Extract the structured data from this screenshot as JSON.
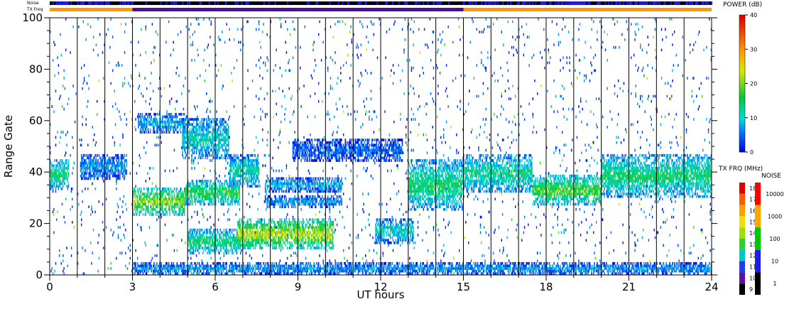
{
  "chart_data": {
    "type": "heatmap",
    "xlabel": "UT hours",
    "ylabel": "Range Gate",
    "xlim": [
      0,
      24
    ],
    "ylim": [
      0,
      100
    ],
    "x_ticks": [
      0,
      3,
      6,
      9,
      12,
      15,
      18,
      21,
      24
    ],
    "y_ticks": [
      0,
      20,
      40,
      60,
      80,
      100
    ],
    "grid_vertical_hours": [
      1,
      2,
      3,
      4,
      5,
      6,
      7,
      8,
      9,
      10,
      11,
      12,
      13,
      14,
      15,
      16,
      17,
      18,
      19,
      20,
      21,
      22,
      23
    ],
    "top_bars": {
      "noise_label": "Noise",
      "txfreq_label": "TX Freq",
      "txfreq_segments": [
        {
          "from": 0,
          "to": 3,
          "color": "#ff9900"
        },
        {
          "from": 3,
          "to": 15,
          "color": "#4b0f96"
        },
        {
          "from": 15,
          "to": 24,
          "color": "#ff9900"
        }
      ]
    },
    "power_scale": {
      "title": "POWER (dB)",
      "min": 0,
      "max": 40,
      "ticks": [
        "40",
        "30",
        "20",
        "10",
        "0"
      ]
    },
    "txfreq_scale": {
      "title": "TX FRQ (MHz)",
      "labels": [
        "18",
        "17",
        "16",
        "15",
        "14",
        "13",
        "12",
        "11",
        "10",
        "9"
      ],
      "colors": [
        "#e00000",
        "#ff5a00",
        "#ffa000",
        "#f0e000",
        "#a0e000",
        "#30d030",
        "#00c8c8",
        "#1e3cf0",
        "#5a14a0",
        "#000000"
      ]
    },
    "noise_scale": {
      "title": "NOISE",
      "labels": [
        "10000",
        "1000",
        "100",
        "10",
        "1"
      ],
      "colors": [
        "#ff0000",
        "#ffa500",
        "#00c800",
        "#1e1ee6",
        "#000000"
      ]
    },
    "echo_regions": [
      {
        "t0": 0.0,
        "t1": 0.7,
        "g0": 33,
        "g1": 44,
        "p": 12
      },
      {
        "t0": 1.1,
        "t1": 2.8,
        "g0": 37,
        "g1": 46,
        "p": 6
      },
      {
        "t0": 3.0,
        "t1": 4.9,
        "g0": 23,
        "g1": 33,
        "p": 17
      },
      {
        "t0": 4.9,
        "t1": 6.9,
        "g0": 27,
        "g1": 36,
        "p": 14
      },
      {
        "t0": 6.5,
        "t1": 7.6,
        "g0": 34,
        "g1": 46,
        "p": 10
      },
      {
        "t0": 3.2,
        "t1": 5.0,
        "g0": 55,
        "g1": 62,
        "p": 7
      },
      {
        "t0": 4.8,
        "t1": 6.5,
        "g0": 45,
        "g1": 60,
        "p": 9
      },
      {
        "t0": 5.0,
        "t1": 6.8,
        "g0": 8,
        "g1": 17,
        "p": 12
      },
      {
        "t0": 6.8,
        "t1": 10.3,
        "g0": 10,
        "g1": 21,
        "p": 19
      },
      {
        "t0": 7.8,
        "t1": 10.6,
        "g0": 32,
        "g1": 37,
        "p": 7
      },
      {
        "t0": 7.8,
        "t1": 10.6,
        "g0": 26,
        "g1": 30,
        "p": 6
      },
      {
        "t0": 8.8,
        "t1": 12.8,
        "g0": 44,
        "g1": 52,
        "p": 4
      },
      {
        "t0": 11.8,
        "t1": 13.2,
        "g0": 12,
        "g1": 21,
        "p": 9
      },
      {
        "t0": 13.0,
        "t1": 15.0,
        "g0": 25,
        "g1": 44,
        "p": 12
      },
      {
        "t0": 15.0,
        "t1": 17.5,
        "g0": 32,
        "g1": 46,
        "p": 11
      },
      {
        "t0": 17.5,
        "t1": 20.0,
        "g0": 27,
        "g1": 38,
        "p": 15
      },
      {
        "t0": 20.0,
        "t1": 24.0,
        "g0": 30,
        "g1": 46,
        "p": 12
      },
      {
        "t0": 3.0,
        "t1": 24.0,
        "g0": 0,
        "g1": 4,
        "p": 6
      }
    ]
  }
}
